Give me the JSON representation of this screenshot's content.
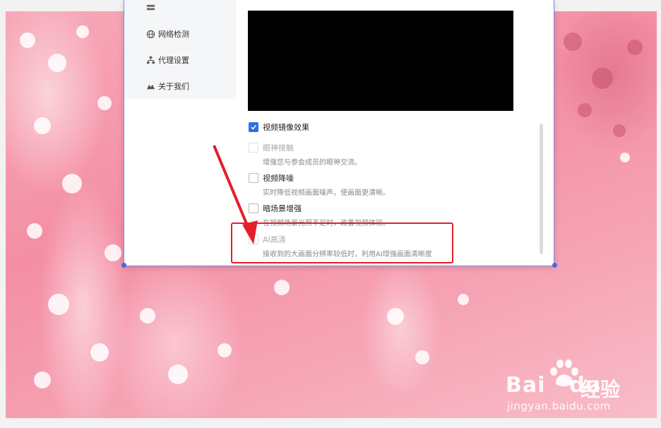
{
  "sidebar": {
    "items": [
      {
        "label": "",
        "icon": "menu-icon"
      },
      {
        "label": "网络检测",
        "icon": "globe-icon"
      },
      {
        "label": "代理设置",
        "icon": "network-icon"
      },
      {
        "label": "关于我们",
        "icon": "mountain-icon"
      }
    ]
  },
  "video_settings": {
    "options": [
      {
        "title": "视频镜像效果",
        "description": "",
        "checked": true,
        "disabled": false
      },
      {
        "title": "眼神接触",
        "description": "增强您与参会成员的眼神交流。",
        "checked": false,
        "disabled": true
      },
      {
        "title": "视频降噪",
        "description": "实时降低视频画面噪声，使画面更清晰。",
        "checked": false,
        "disabled": false
      },
      {
        "title": "暗场景增强",
        "description": "在视频场景光照不足时，改善视频体验。",
        "checked": false,
        "disabled": false
      },
      {
        "title": "AI高清",
        "description": "接收到的大画面分辨率较低时，利用AI增强画面清晰度",
        "checked": false,
        "disabled": true
      }
    ]
  },
  "colors": {
    "accent": "#2f6fe8",
    "annotation": "#e4202a",
    "window_border": "#7a8cf0"
  },
  "watermark": {
    "logo": "Bai",
    "logo_suffix": "du",
    "brand_cn": "经验",
    "url": "jingyan.baidu.com"
  }
}
